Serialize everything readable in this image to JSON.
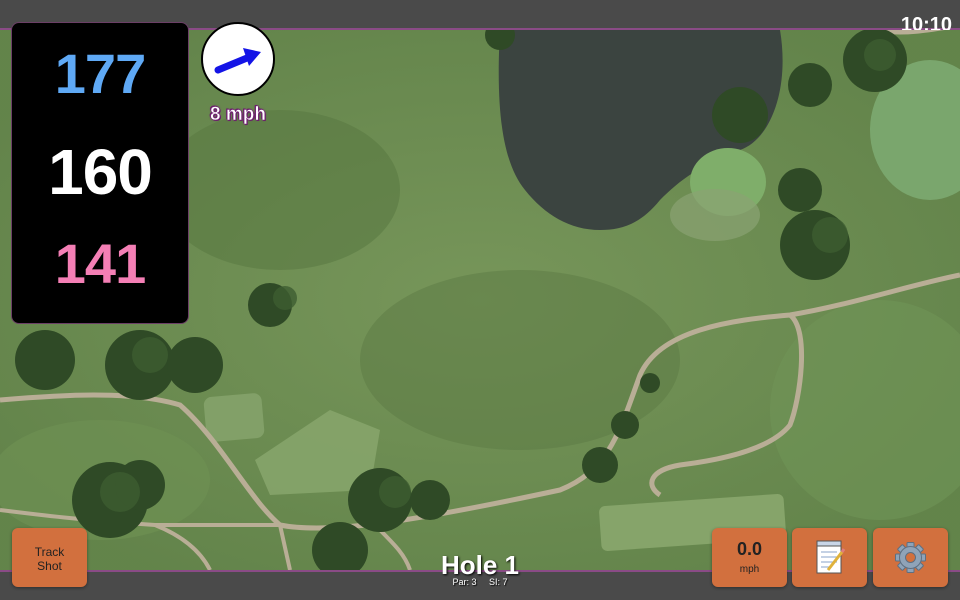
{
  "status": {
    "time": "10:10"
  },
  "distances": {
    "back": "177",
    "middle": "160",
    "front": "141"
  },
  "wind": {
    "speed_label": "8 mph"
  },
  "buttons": {
    "track_shot_line1": "Track",
    "track_shot_line2": "Shot",
    "speed_value": "0.0",
    "speed_unit": "mph",
    "notes_icon": "notepad-icon",
    "settings_icon": "gear-icon"
  },
  "hole": {
    "title": "Hole 1",
    "par": "Par: 3",
    "si": "SI: 7"
  },
  "colors": {
    "back": "#5fa9f5",
    "middle": "#ffffff",
    "front": "#f47fb5",
    "button": "#d2703e",
    "accent": "#8a4b86"
  }
}
